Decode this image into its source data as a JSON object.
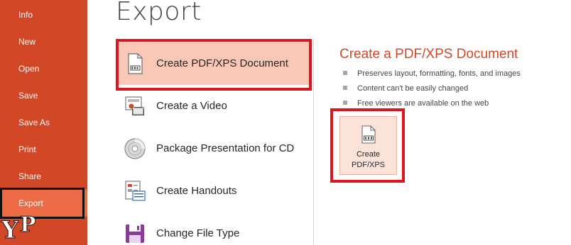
{
  "nav": {
    "items": [
      {
        "label": "Info"
      },
      {
        "label": "New"
      },
      {
        "label": "Open"
      },
      {
        "label": "Save"
      },
      {
        "label": "Save As"
      },
      {
        "label": "Print"
      },
      {
        "label": "Share"
      },
      {
        "label": "Export"
      }
    ],
    "selected": "Export"
  },
  "logo": {
    "letters": [
      "Y",
      "P"
    ]
  },
  "page": {
    "title": "Export"
  },
  "options": [
    {
      "label": "Create PDF/XPS Document",
      "icon": "pdf-document-icon",
      "selected": true
    },
    {
      "label": "Create a Video",
      "icon": "video-icon"
    },
    {
      "label": "Package Presentation for CD",
      "icon": "cd-icon"
    },
    {
      "label": "Create Handouts",
      "icon": "handouts-icon"
    },
    {
      "label": "Change File Type",
      "icon": "save-file-type-icon"
    }
  ],
  "detail": {
    "title": "Create a PDF/XPS Document",
    "bullets": [
      "Preserves layout, formatting, fonts, and images",
      "Content can't be easily changed",
      "Free viewers are available on the web"
    ],
    "button": {
      "line1": "Create",
      "line2": "PDF/XPS",
      "icon": "pdf-document-icon"
    }
  },
  "colors": {
    "nav_bg": "#d24726",
    "nav_selected": "#ec6b45",
    "option_selected": "#f9c8b4",
    "highlight_outline": "#e1141d",
    "accent_title": "#d24726"
  }
}
